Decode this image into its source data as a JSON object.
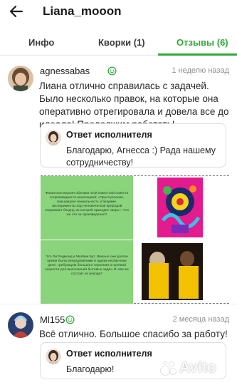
{
  "header": {
    "title": "Liana_mooon",
    "back_icon": "arrow-left-icon"
  },
  "tabs": [
    {
      "label": "Инфо",
      "active": false
    },
    {
      "label": "Кворки (1)",
      "active": false
    },
    {
      "label": "Отзывы (6)",
      "active": true
    }
  ],
  "colors": {
    "accent_green": "#2faa3a",
    "attachment_green": "#8ad47c"
  },
  "reviews": [
    {
      "username": "agnessabas",
      "badge_icon": "positive-review-smile-icon",
      "date": "1 неделю назад",
      "text": "Лиана отлично справилась с задачей. Было несколько правок, на которые она оперативно отрегировала и довела все до идеала! Продолжим работать!",
      "reply": {
        "title": "Ответ исполнителя",
        "text": "Благодарю, Агнесса :) Рада нашему сотрудничеству!"
      },
      "attachment": {
        "text_1": "Фанатская версия обложки этой известной повести сопровождается аннотацией: «Преступление, смешавшее гениальность и безумие. Эксперименты над человеческой природой открывают бездну, из которой приходит зверь». Что же это за произведение?",
        "text_2": "Это Ли Редмонд и Мелвин Бут. Именно они долгое время были рекордсменами в одном необычном деле, требующем большого терпения и нулевой скорости для выполнения бытовых задач. В чём же состоит их рекорд?"
      }
    },
    {
      "username": "Ml155",
      "badge_icon": "positive-review-smile-icon",
      "date": "2 месяца назад",
      "text": "Всё отлично. Большое спасибо за работу!",
      "reply": {
        "title": "Ответ исполнителя",
        "text": "Благодарю!"
      }
    }
  ],
  "watermark": {
    "text": "Avito"
  }
}
